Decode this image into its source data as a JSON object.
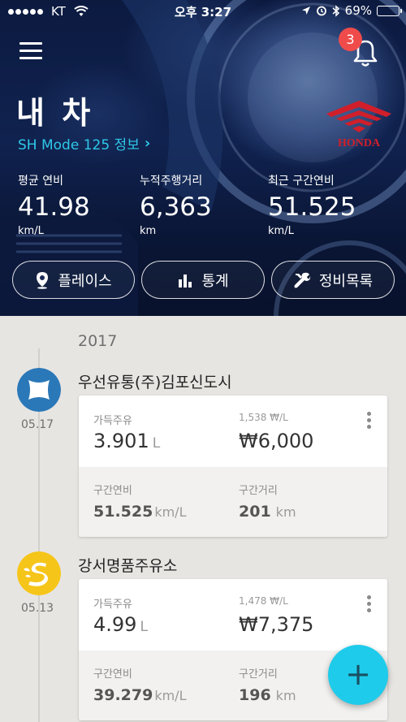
{
  "status_bar": {
    "carrier": "KT",
    "time": "오후 3:27",
    "battery_percent": "69%",
    "battery_level": 0.69,
    "icons": [
      "signal-dots-icon",
      "wifi-icon",
      "location-arrow-icon",
      "alarm-icon",
      "bluetooth-icon",
      "battery-icon"
    ]
  },
  "header": {
    "notification_count": "3",
    "title": "내 차",
    "model_link": "SH Mode 125 정보",
    "brand_logo_text": "HONDA",
    "stats": [
      {
        "label": "평균 연비",
        "value": "41.98",
        "unit": "km/L"
      },
      {
        "label": "누적주행거리",
        "value": "6,363",
        "unit": "km"
      },
      {
        "label": "최근 구간연비",
        "value": "51.525",
        "unit": "km/L"
      }
    ],
    "buttons": [
      {
        "label": "플레이스",
        "icon": "map-pin-icon"
      },
      {
        "label": "통계",
        "icon": "bar-chart-icon"
      },
      {
        "label": "정비목록",
        "icon": "wrench-icon"
      }
    ]
  },
  "timeline": {
    "year": "2017",
    "entries": [
      {
        "station": "우선유통(주)김포신도시",
        "brand_icon": "hyundai-oilbank-icon",
        "date": "05.17",
        "fuel_type_label": "가득주유",
        "amount": "3.901",
        "amount_unit": "L",
        "unit_price": "1,538 ₩/L",
        "cost": "₩6,000",
        "efficiency_label": "구간연비",
        "efficiency": "51.525",
        "efficiency_unit": "km/L",
        "distance_label": "구간거리",
        "distance": "201",
        "distance_unit": "km"
      },
      {
        "station": "강서명품주유소",
        "brand_icon": "s-oil-icon",
        "date": "05.13",
        "fuel_type_label": "가득주유",
        "amount": "4.99",
        "amount_unit": "L",
        "unit_price": "1,478 ₩/L",
        "cost": "₩7,375",
        "efficiency_label": "구간연비",
        "efficiency": "39.279",
        "efficiency_unit": "km/L",
        "distance_label": "구간거리",
        "distance": "196",
        "distance_unit": "km"
      }
    ]
  },
  "fab": {
    "label": "+"
  },
  "colors": {
    "accent": "#2fc7e8",
    "fab": "#1ecbea",
    "badge": "#f04b4b",
    "honda_red": "#d01f2b",
    "hyundai_blue": "#2b78b8",
    "soil_yellow": "#f6c519"
  }
}
